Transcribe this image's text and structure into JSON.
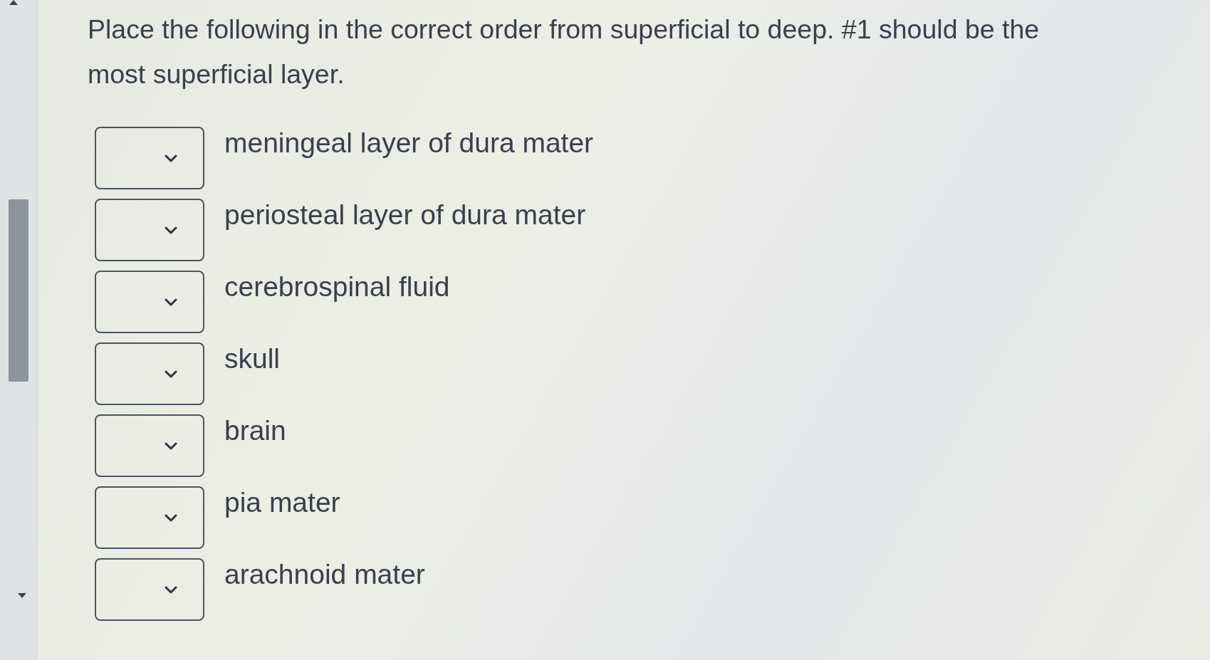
{
  "question": "Place the following in the correct order from superficial to deep. #1 should be the most superficial layer.",
  "items": [
    {
      "label": "meningeal layer of dura mater"
    },
    {
      "label": "periosteal layer of dura mater"
    },
    {
      "label": "cerebrospinal fluid"
    },
    {
      "label": "skull"
    },
    {
      "label": "brain"
    },
    {
      "label": "pia mater"
    },
    {
      "label": "arachnoid mater"
    }
  ]
}
